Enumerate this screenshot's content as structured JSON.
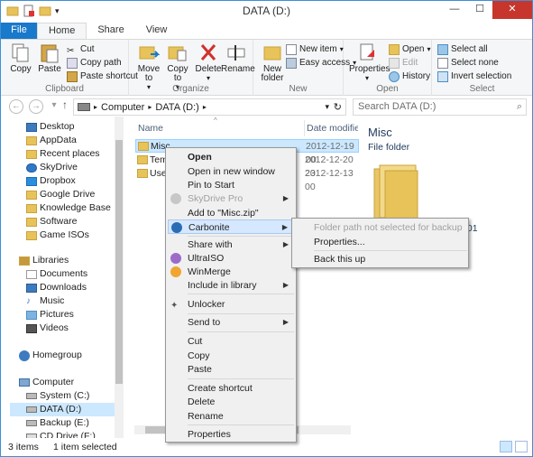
{
  "window": {
    "title": "DATA (D:)"
  },
  "ribbon_tabs": [
    "File",
    "Home",
    "Share",
    "View"
  ],
  "ribbon": {
    "clipboard": {
      "label": "Clipboard",
      "copy": "Copy",
      "paste": "Paste",
      "cut": "Cut",
      "copy_path": "Copy path",
      "paste_shortcut": "Paste shortcut"
    },
    "organize": {
      "label": "Organize",
      "move_to": "Move to",
      "copy_to": "Copy to",
      "delete": "Delete",
      "rename": "Rename"
    },
    "new": {
      "label": "New",
      "new_folder": "New folder",
      "new_item": "New item",
      "easy_access": "Easy access"
    },
    "open": {
      "label": "Open",
      "properties": "Properties",
      "open": "Open",
      "edit": "Edit",
      "history": "History"
    },
    "select": {
      "label": "Select",
      "select_all": "Select all",
      "select_none": "Select none",
      "invert_selection": "Invert selection"
    }
  },
  "address": {
    "path": [
      "Computer",
      "DATA (D:)"
    ],
    "search_placeholder": "Search DATA (D:)"
  },
  "nav_pane": {
    "favorites": [
      "Desktop",
      "AppData",
      "Recent places",
      "SkyDrive",
      "Dropbox",
      "Google Drive",
      "Knowledge Base",
      "Software",
      "Game ISOs"
    ],
    "libraries_label": "Libraries",
    "libraries": [
      "Documents",
      "Downloads",
      "Music",
      "Pictures",
      "Videos"
    ],
    "homegroup_label": "Homegroup",
    "computer_label": "Computer",
    "drives": [
      "System (C:)",
      "DATA (D:)",
      "Backup (E:)",
      "CD Drive (F:)"
    ]
  },
  "file_list": {
    "columns": {
      "name": "Name",
      "date": "Date modified"
    },
    "rows": [
      {
        "name": "Misc",
        "date": "2012-12-19 00"
      },
      {
        "name": "Tem",
        "date": "2012-12-20 23"
      },
      {
        "name": "User",
        "date": "2012-12-13 00"
      }
    ]
  },
  "details": {
    "name": "Misc",
    "type": "File folder",
    "fragment": ":01"
  },
  "status": {
    "count": "3 items",
    "selected": "1 item selected"
  },
  "context_menu": {
    "open": "Open",
    "open_new_window": "Open in new window",
    "pin_to_start": "Pin to Start",
    "skydrive_pro": "SkyDrive Pro",
    "add_to_zip": "Add to \"Misc.zip\"",
    "carbonite": "Carbonite",
    "share_with": "Share with",
    "ultraiso": "UltraISO",
    "winmerge": "WinMerge",
    "include_in_library": "Include in library",
    "unlocker": "Unlocker",
    "send_to": "Send to",
    "cut": "Cut",
    "copy": "Copy",
    "paste": "Paste",
    "create_shortcut": "Create shortcut",
    "delete": "Delete",
    "rename": "Rename",
    "properties": "Properties"
  },
  "submenu": {
    "not_selected": "Folder path not selected for backup",
    "properties": "Properties...",
    "back_up": "Back this up"
  },
  "colors": {
    "accent": "#1979ca",
    "selection": "#cce8ff",
    "folder": "#e7c35a",
    "close": "#c7362c"
  }
}
